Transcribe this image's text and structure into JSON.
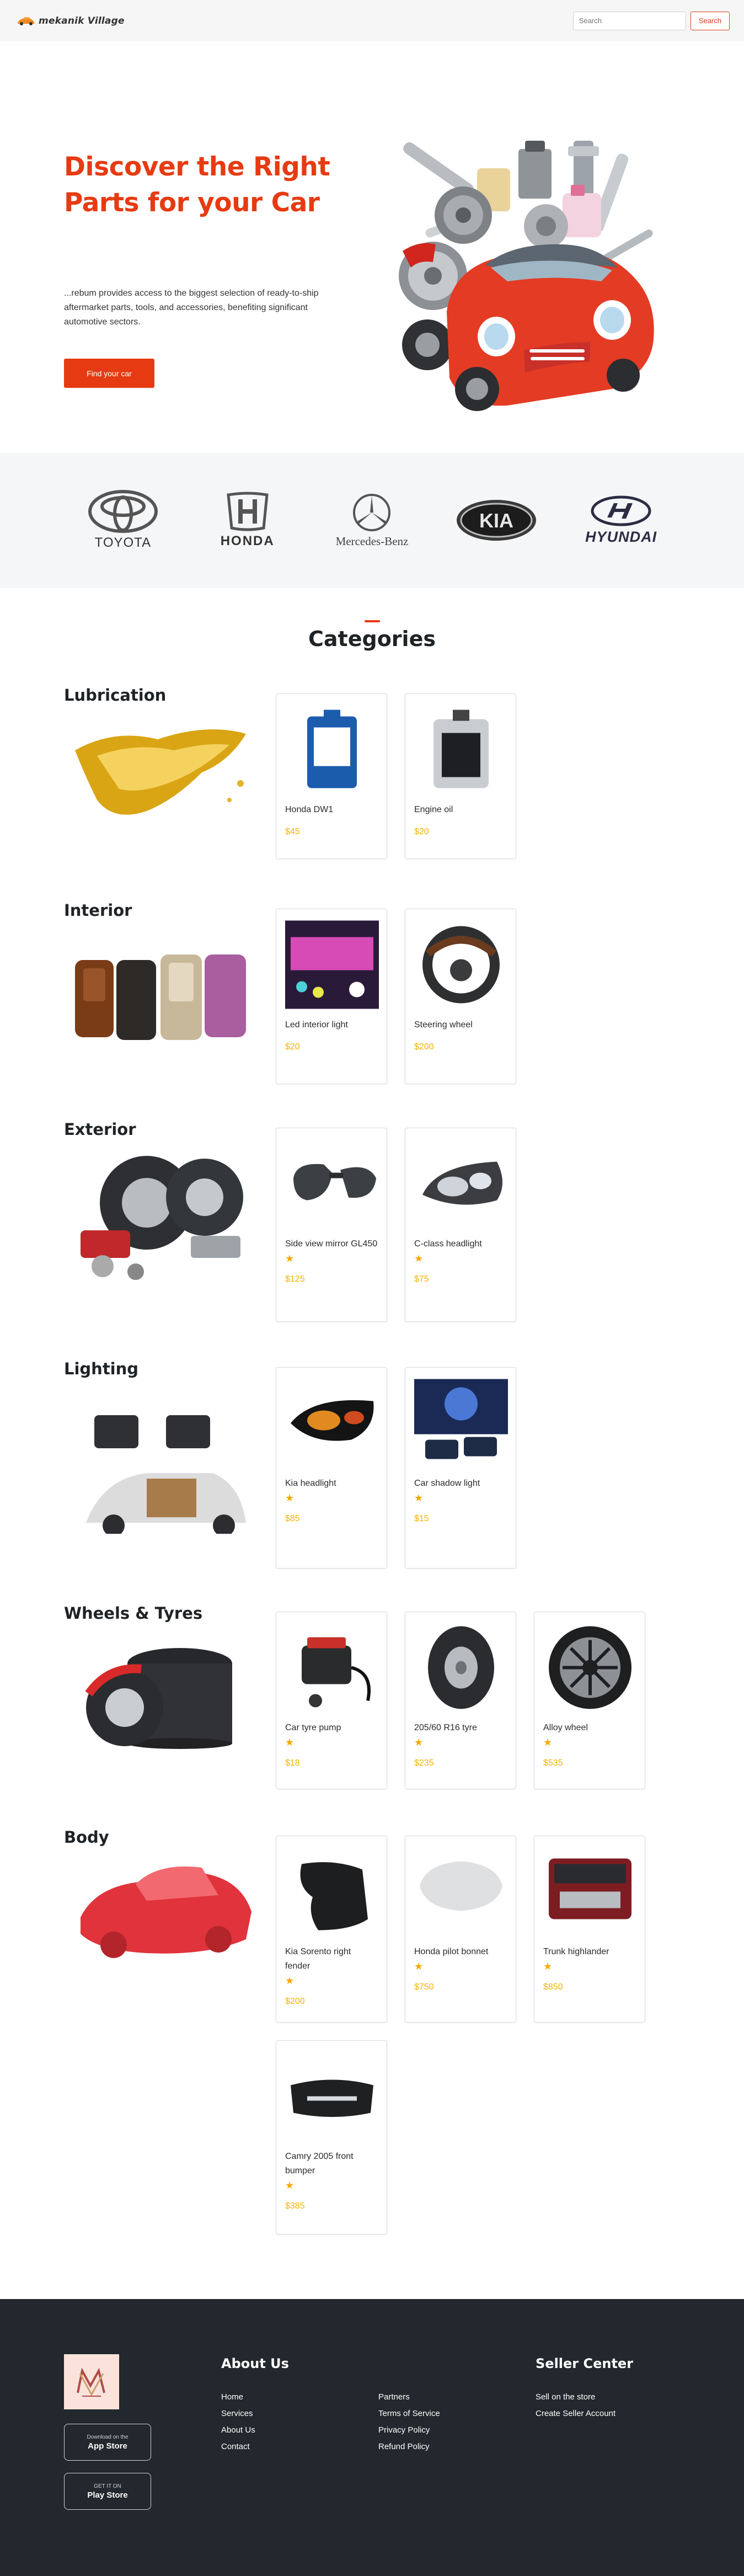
{
  "header": {
    "logo_text": "mekanik Village",
    "search_placeholder": "Search",
    "search_button": "Search"
  },
  "hero": {
    "title": "Discover the Right Parts for your Car",
    "description": "...rebum provides access to the biggest selection of ready-to-ship aftermarket parts, tools, and accessories, benefiting significant automotive sectors.",
    "cta": "Find your car"
  },
  "brands": [
    "TOYOTA",
    "HONDA",
    "Mercedes-Benz",
    "KIA",
    "HYUNDAI"
  ],
  "categories_title": "Categories",
  "categories": [
    {
      "name": "Lubrication",
      "products": [
        {
          "name": "Honda DW1",
          "price": "$45",
          "rating": 0
        },
        {
          "name": "Engine oil",
          "price": "$20",
          "rating": 0
        }
      ]
    },
    {
      "name": "Interior",
      "products": [
        {
          "name": "Led interior light",
          "price": "$20",
          "rating": 0
        },
        {
          "name": "Steering wheel",
          "price": "$200",
          "rating": 0
        }
      ]
    },
    {
      "name": "Exterior",
      "products": [
        {
          "name": "Side view mirror GL450",
          "price": "$125",
          "rating": 1
        },
        {
          "name": "C-class headlight",
          "price": "$75",
          "rating": 1
        }
      ]
    },
    {
      "name": "Lighting",
      "products": [
        {
          "name": "Kia headlight",
          "price": "$85",
          "rating": 1
        },
        {
          "name": "Car shadow light",
          "price": "$15",
          "rating": 1
        }
      ]
    },
    {
      "name": "Wheels & Tyres",
      "products": [
        {
          "name": "Car tyre pump",
          "price": "$18",
          "rating": 1
        },
        {
          "name": "205/60 R16 tyre",
          "price": "$235",
          "rating": 1
        },
        {
          "name": "Alloy wheel",
          "price": "$535",
          "rating": 1
        }
      ]
    },
    {
      "name": "Body",
      "products": [
        {
          "name": "Kia Sorento right fender",
          "price": "$200",
          "rating": 1
        },
        {
          "name": "Honda pilot bonnet",
          "price": "$750",
          "rating": 1
        },
        {
          "name": "Trunk highlander",
          "price": "$850",
          "rating": 1
        },
        {
          "name": "Camry 2005 front bumper",
          "price": "$385",
          "rating": 1
        }
      ]
    }
  ],
  "footer": {
    "app_store_small": "Download on the",
    "app_store": "App Store",
    "play_store_small": "GET IT ON",
    "play_store": "Play Store",
    "about_title": "About Us",
    "about_links": [
      "Home",
      "Services",
      "About Us",
      "Contact"
    ],
    "more_links": [
      "Partners",
      "Terms of Service",
      "Privacy Policy",
      "Refund Policy"
    ],
    "seller_title": "Seller Center",
    "seller_links": [
      "Sell on the store",
      "Create Seller Account"
    ]
  },
  "colors": {
    "accent": "#e63b12",
    "price": "#f5b300",
    "star": "#f5a800",
    "footer": "#22282d"
  },
  "star_glyph": "★"
}
